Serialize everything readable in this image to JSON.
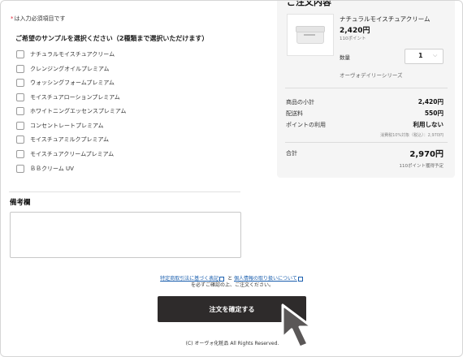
{
  "form": {
    "required_mark": "*",
    "required_note": "は入力必須項目です",
    "sample_heading": "ご希望のサンプルを選択ください（2種類まで選択いただけます）",
    "samples": [
      "ナチュラルモイスチュアクリーム",
      "クレンジングオイルプレミアム",
      "ウォッシングフォームプレミアム",
      "モイスチュアローションプレミアム",
      "ホワイトニングエッセンスプレミアム",
      "コンセントレートプレミアム",
      "モイスチュアミルクプレミアム",
      "モイスチュアクリームプレミアム",
      "ＢＢクリーム UV"
    ],
    "remarks_title": "備考欄",
    "remarks_value": ""
  },
  "order": {
    "title": "ご注文内容",
    "product_name": "ナチュラルモイスチュアクリーム",
    "price": "2,420円",
    "points": "110ポイント",
    "qty_label": "数量",
    "qty_value": "1",
    "chevron_icon": "chevron-down-icon",
    "series": "オーヴォデイリーシリーズ",
    "subtotal_label": "商品の小計",
    "subtotal_value": "2,420円",
    "shipping_label": "配送料",
    "shipping_value": "550円",
    "points_use_label": "ポイントの利用",
    "points_use_value": "利用しない",
    "tax_note": "消費税10%対象（税込）：2,970円",
    "total_label": "合計",
    "total_value": "2,970円",
    "total_points": "110ポイント獲得予定"
  },
  "footer": {
    "link_commerce": "特定商取引法に基づく表記",
    "conjunction": "と",
    "link_privacy": "個人情報の取り扱いについて",
    "confirm_note": "を必ずご確認の上、ご注文ください。",
    "submit_label": "注文を確定する",
    "copyright": "(C) オーヴォ化粧品 All Rights Reserved.",
    "cursor_icon": "arrow-cursor-icon"
  }
}
